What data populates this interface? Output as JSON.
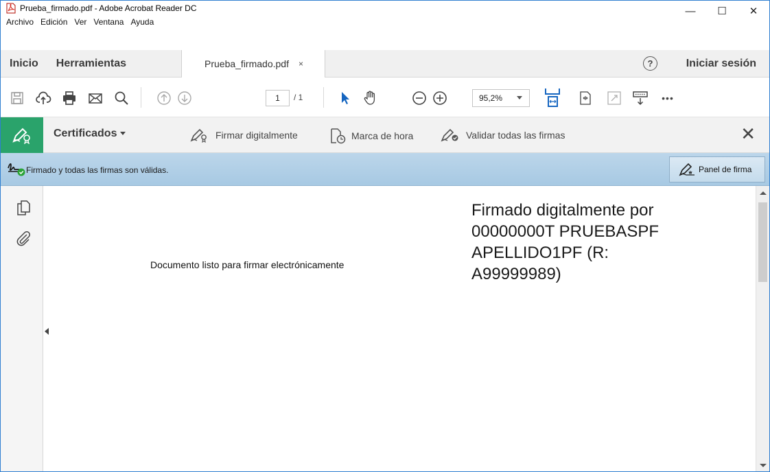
{
  "window": {
    "title": "Prueba_firmado.pdf - Adobe Acrobat Reader DC",
    "controls": {
      "minimize": "—",
      "maximize": "☐",
      "close": "✕"
    }
  },
  "menubar": {
    "items": [
      "Archivo",
      "Edición",
      "Ver",
      "Ventana",
      "Ayuda"
    ]
  },
  "nav": {
    "home": "Inicio",
    "tools": "Herramientas",
    "document_tab": "Prueba_firmado.pdf",
    "tab_close": "×",
    "help": "?",
    "sign_in": "Iniciar sesión"
  },
  "toolbar": {
    "current_page": "1",
    "total_pages": "/ 1",
    "zoom": "95,2%",
    "icons": [
      "save-icon",
      "upload-cloud-icon",
      "print-icon",
      "email-icon",
      "search-icon",
      "page-up-icon",
      "page-down-icon",
      "select-arrow-icon",
      "hand-tool-icon",
      "zoom-out-icon",
      "zoom-in-icon",
      "fit-page-icon",
      "rotate-icon",
      "fullscreen-icon",
      "scroll-mode-icon",
      "more-icon"
    ],
    "more": "•••"
  },
  "certificates": {
    "title": "Certificados",
    "actions": {
      "sign_digitally": "Firmar digitalmente",
      "timestamp": "Marca de hora",
      "validate_all": "Validar todas las firmas"
    },
    "close": "✕"
  },
  "signature_bar": {
    "status": "Firmado y todas las firmas son válidas.",
    "panel_button": "Panel de firma"
  },
  "document": {
    "body_text": "Documento listo para firmar electrónicamente",
    "stamp_lines": [
      "Firmado digitalmente por",
      "00000000T PRUEBASPF",
      "APELLIDO1PF (R:",
      "A99999989)"
    ]
  },
  "colors": {
    "certificates_accent": "#2aa36b",
    "signature_bar": "#bcd6ea",
    "selection_arrow": "#1565c0"
  }
}
